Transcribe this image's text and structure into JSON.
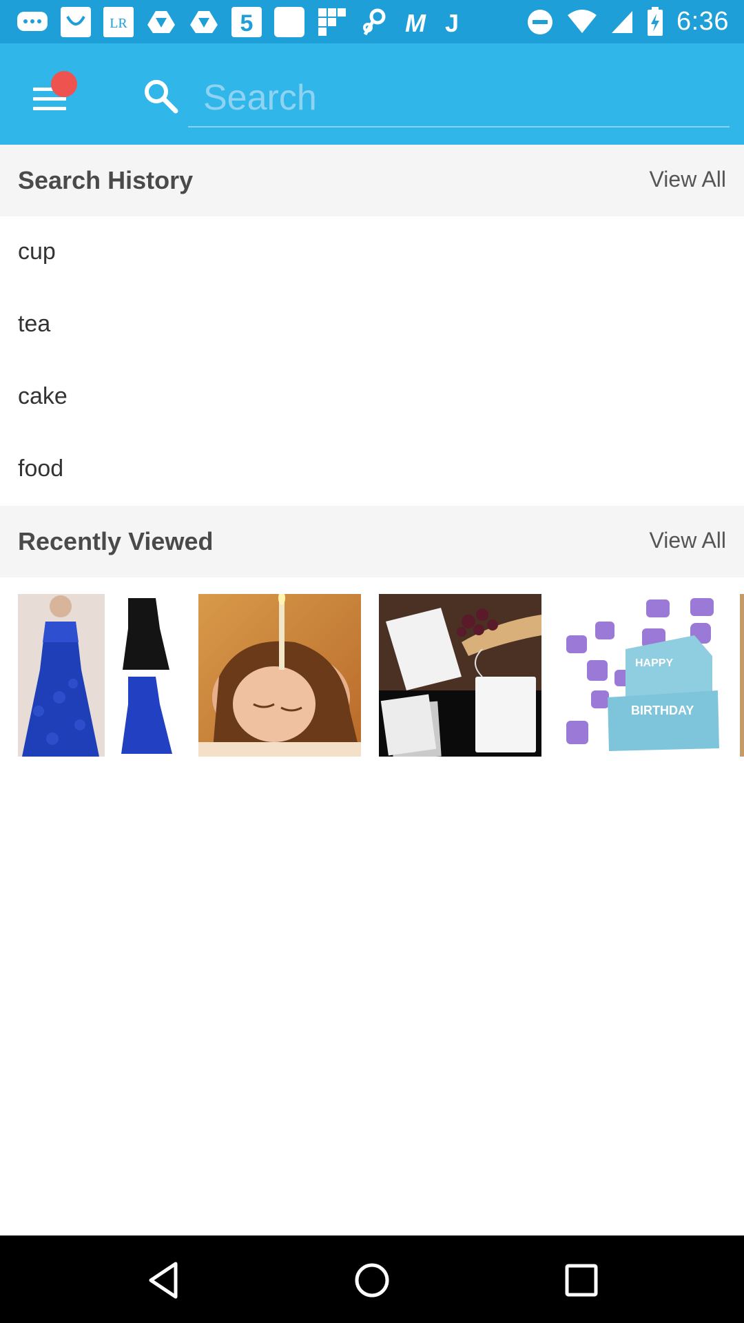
{
  "status_bar": {
    "time": "6:36",
    "notification_icons": [
      "messenger-icon",
      "unicode-app-icon",
      "lr-app-icon",
      "drive-icon",
      "drive-icon",
      "number5-app-icon",
      "blank-app-icon",
      "grid-app-icon",
      "link-app-icon",
      "m-app-icon",
      "j-app-icon"
    ],
    "lr_label": "LR",
    "five_label": "5",
    "m_label": "M",
    "j_label": "J"
  },
  "toolbar": {
    "search_placeholder": "Search",
    "search_value": ""
  },
  "search_history": {
    "title": "Search History",
    "view_all": "View All",
    "items": [
      {
        "label": "cup"
      },
      {
        "label": "tea"
      },
      {
        "label": "cake"
      },
      {
        "label": "food"
      }
    ]
  },
  "recently_viewed": {
    "title": "Recently Viewed",
    "view_all": "View All",
    "items": [
      {
        "name": "blue-lace-dress-product"
      },
      {
        "name": "ear-candle-spa-product"
      },
      {
        "name": "tea-bag-filter-product"
      },
      {
        "name": "birthday-cake-cutter-product",
        "cake_text_top": "HAPPY",
        "cake_text_bottom": "BIRTHDAY"
      }
    ]
  },
  "colors": {
    "status_bar": "#1e9fd8",
    "toolbar": "#31b6e9",
    "notification_dot": "#ef5350",
    "section_bg": "#f5f5f5"
  }
}
